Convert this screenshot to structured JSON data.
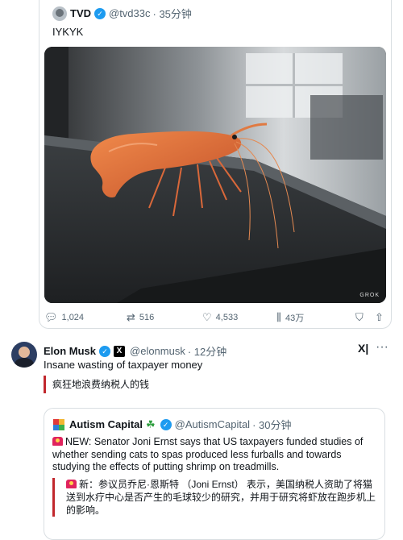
{
  "tweet1": {
    "name": "TVD",
    "handle": "@tvd33c",
    "time": "· 35分钟",
    "text": "IYKYK",
    "watermark": "GROK",
    "stats": {
      "replies": "1,024",
      "reposts": "516",
      "likes": "4,533",
      "views": "43万"
    }
  },
  "tweet2": {
    "name": "Elon Musk",
    "handle": "@elonmusk",
    "time": "· 12分钟",
    "text": "Insane wasting of taxpayer money",
    "translation": "疯狂地浪费纳税人的钱",
    "grok_label": "X|",
    "more_label": "···"
  },
  "quote": {
    "name": "Autism Capital",
    "handle": "@AutismCapital",
    "time": "· 30分钟",
    "text": "NEW: Senator Joni Ernst says that US taxpayers funded studies of whether sending cats to spas produced less furballs and towards studying the effects of putting shrimp on treadmills.",
    "translation": "新：参议员乔尼·恩斯特 （Joni Ernst） 表示，美国纳税人资助了将猫送到水疗中心是否产生的毛球较少的研究，并用于研究将虾放在跑步机上的影响。"
  },
  "colors": {
    "verified": "#1d9bf0",
    "translation_bar": "#c1272d",
    "siren": "#e0245e"
  }
}
